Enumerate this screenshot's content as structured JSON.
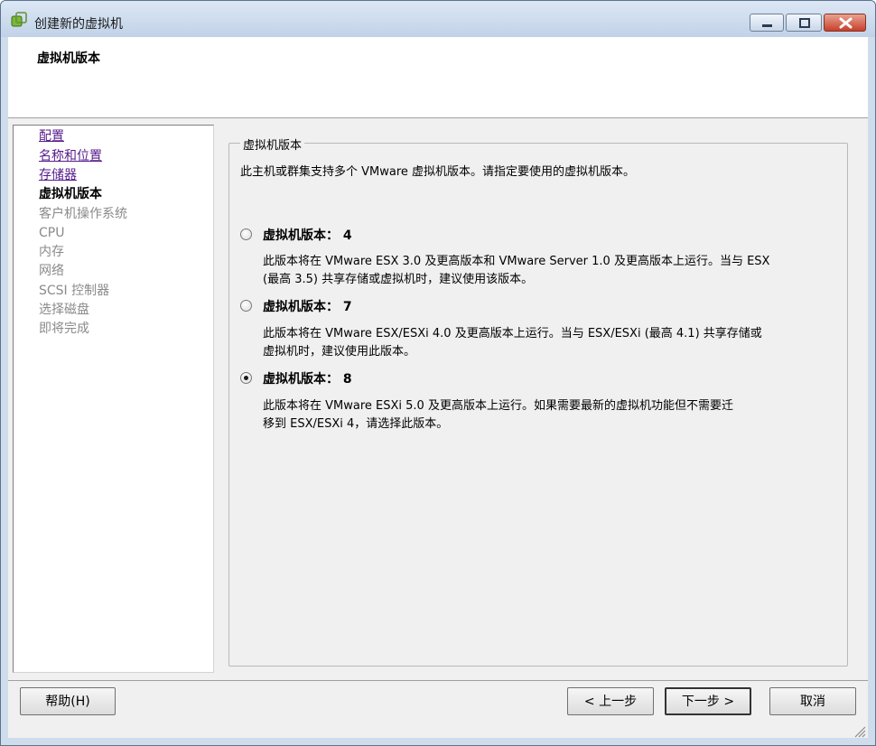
{
  "window": {
    "title": "创建新的虚拟机",
    "controls": [
      "minimize",
      "maximize",
      "close"
    ]
  },
  "header": {
    "title": "虚拟机版本"
  },
  "steps": [
    {
      "label": "配置",
      "state": "completed"
    },
    {
      "label": "名称和位置",
      "state": "completed"
    },
    {
      "label": "存储器",
      "state": "completed"
    },
    {
      "label": "虚拟机版本",
      "state": "current"
    },
    {
      "label": "客户机操作系统",
      "state": "pending"
    },
    {
      "label": "CPU",
      "state": "pending"
    },
    {
      "label": "内存",
      "state": "pending"
    },
    {
      "label": "网络",
      "state": "pending"
    },
    {
      "label": "SCSI 控制器",
      "state": "pending"
    },
    {
      "label": "选择磁盘",
      "state": "pending"
    },
    {
      "label": "即将完成",
      "state": "pending"
    }
  ],
  "group": {
    "legend": "虚拟机版本",
    "intro": "此主机或群集支持多个 VMware 虚拟机版本。请指定要使用的虚拟机版本。",
    "options": [
      {
        "label": "虚拟机版本： 4",
        "desc_line1": "此版本将在 VMware ESX 3.0 及更高版本和 VMware Server 1.0 及更高版本上运行。当与 ESX",
        "desc_line2": "(最高 3.5) 共享存储或虚拟机时，建议使用该版本。",
        "selected": false
      },
      {
        "label": "虚拟机版本： 7",
        "desc_line1": "此版本将在 VMware ESX/ESXi 4.0 及更高版本上运行。当与 ESX/ESXi (最高 4.1) 共享存储或",
        "desc_line2": "虚拟机时，建议使用此版本。",
        "selected": false
      },
      {
        "label": "虚拟机版本： 8",
        "desc_line1": "此版本将在 VMware ESXi 5.0 及更高版本上运行。如果需要最新的虚拟机功能但不需要迁",
        "desc_line2": "移到 ESX/ESXi 4，请选择此版本。",
        "selected": true
      }
    ]
  },
  "buttons": {
    "help": "帮助(H)",
    "back": "< 上一步",
    "next": "下一步 >",
    "cancel": "取消"
  },
  "colors": {
    "link_visited": "#551a8b",
    "pending_step": "#8a8a8a",
    "close_button": "#c7402a"
  }
}
